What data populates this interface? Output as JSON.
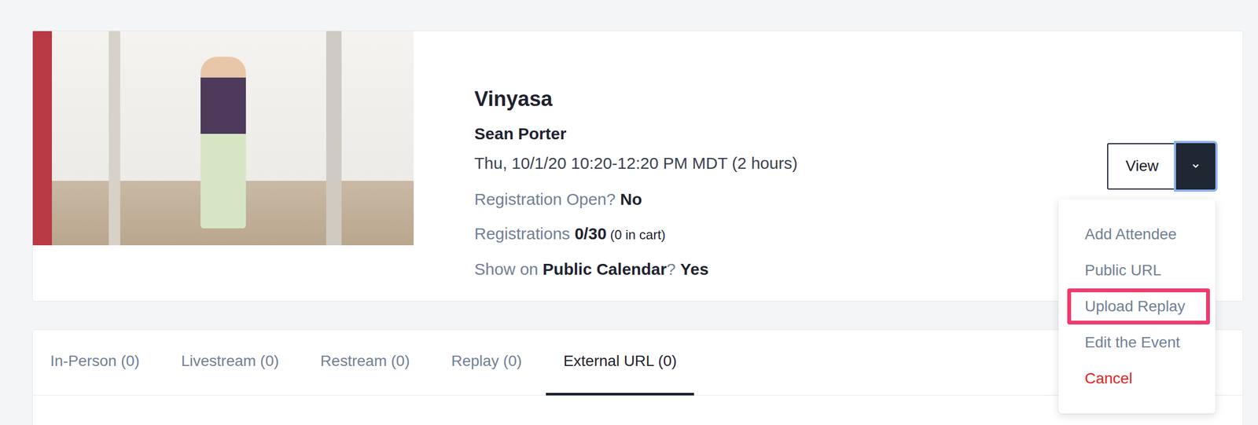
{
  "event": {
    "title": "Vinyasa",
    "instructor": "Sean Porter",
    "schedule": "Thu, 10/1/20 10:20-12:20 PM MDT (2 hours)"
  },
  "details": [
    {
      "parts": [
        {
          "text": "Registration Open? ",
          "kind": "label"
        },
        {
          "text": "No",
          "kind": "value"
        }
      ]
    },
    {
      "parts": [
        {
          "text": "Registrations ",
          "kind": "label"
        },
        {
          "text": "0/30",
          "kind": "value"
        },
        {
          "text": " (0 in cart)",
          "kind": "note"
        }
      ]
    },
    {
      "parts": [
        {
          "text": "Show on ",
          "kind": "label"
        },
        {
          "text": "Public Calendar",
          "kind": "value"
        },
        {
          "text": "? ",
          "kind": "label"
        },
        {
          "text": "Yes",
          "kind": "value"
        }
      ]
    }
  ],
  "actions": {
    "view_button": "View",
    "menu_open": true,
    "menu": [
      {
        "label": "Add Attendee",
        "highlighted": false,
        "kind": "normal"
      },
      {
        "label": "Public URL",
        "highlighted": false,
        "kind": "normal"
      },
      {
        "label": "Upload Replay",
        "highlighted": true,
        "kind": "normal"
      },
      {
        "label": "Edit the Event",
        "highlighted": false,
        "kind": "normal"
      },
      {
        "label": "Cancel",
        "highlighted": false,
        "kind": "danger"
      }
    ]
  },
  "tabs": [
    {
      "label": "In-Person (0)",
      "selected": false
    },
    {
      "label": "Livestream (0)",
      "selected": false
    },
    {
      "label": "Restream (0)",
      "selected": false
    },
    {
      "label": "Replay (0)",
      "selected": false
    },
    {
      "label": "External URL (0)",
      "selected": true
    }
  ]
}
